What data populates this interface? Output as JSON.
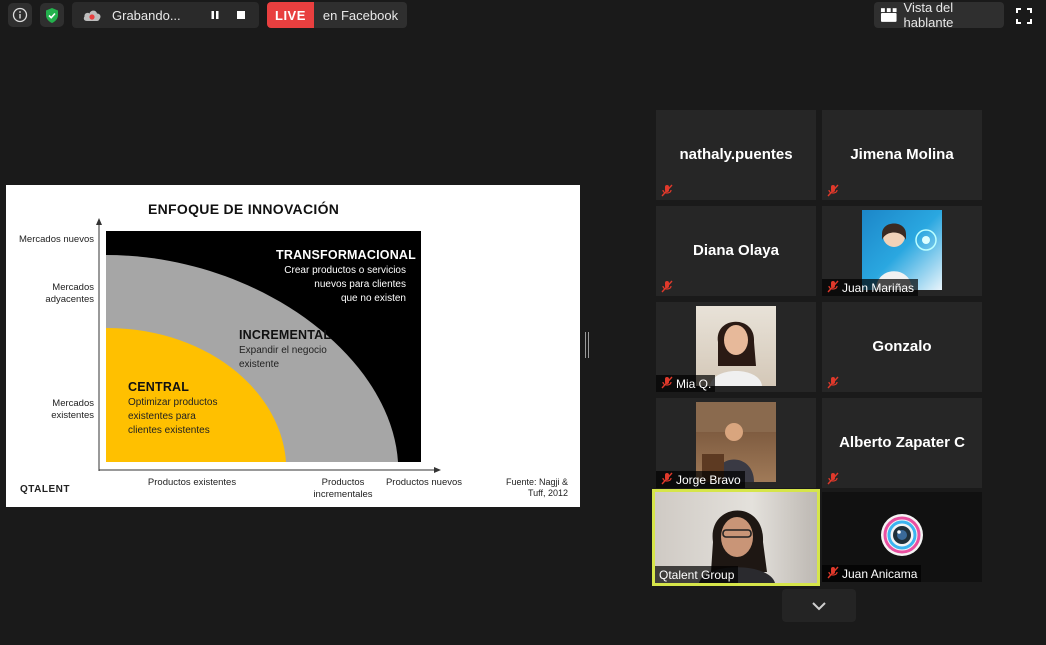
{
  "topbar": {
    "recording_label": "Grabando...",
    "live_label": "LIVE",
    "live_target": "en Facebook",
    "speaker_view_label": "Vista del hablante"
  },
  "slide": {
    "title": "ENFOQUE DE INNOVACIÓN",
    "y_labels": [
      "Mercados nuevos",
      "Mercados adyacentes",
      "Mercados existentes"
    ],
    "x_labels": [
      "Productos existentes",
      "Productos incrementales",
      "Productos nuevos"
    ],
    "zones": [
      {
        "title": "TRANSFORMACIONAL",
        "desc": [
          "Crear productos o servicios",
          "nuevos para clientes",
          "que no existen"
        ]
      },
      {
        "title": "INCREMENTAL",
        "desc": [
          "Expandir el negocio",
          "existente"
        ]
      },
      {
        "title": "CENTRAL",
        "desc": [
          "Optimizar productos",
          "existentes para",
          "clientes existentes"
        ]
      }
    ],
    "source": [
      "Fuente: Nagji &",
      "Tuff, 2012"
    ],
    "brand": "QTALENT",
    "colors": {
      "transformacional": "#000000",
      "incremental": "#a6a6a6",
      "central": "#ffc000"
    }
  },
  "participants": [
    {
      "name": "nathaly.puentes",
      "video": false
    },
    {
      "name": "Jimena Molina",
      "video": false
    },
    {
      "name": "Diana Olaya",
      "video": false
    },
    {
      "name": "Juan Mariñas",
      "video": true
    },
    {
      "name": "Mia Q.",
      "video": true
    },
    {
      "name": "Gonzalo",
      "video": false
    },
    {
      "name": "Jorge Bravo",
      "video": true
    },
    {
      "name": "Alberto Zapater C",
      "video": false
    },
    {
      "name": "Qtalent Group",
      "video": true,
      "active_speaker": true
    },
    {
      "name": "Juan Anicama",
      "video": true
    }
  ],
  "colors": {
    "live_red": "#e83f3f",
    "active_speaker_border": "#d6e54a",
    "mute_red": "#e0392b"
  }
}
